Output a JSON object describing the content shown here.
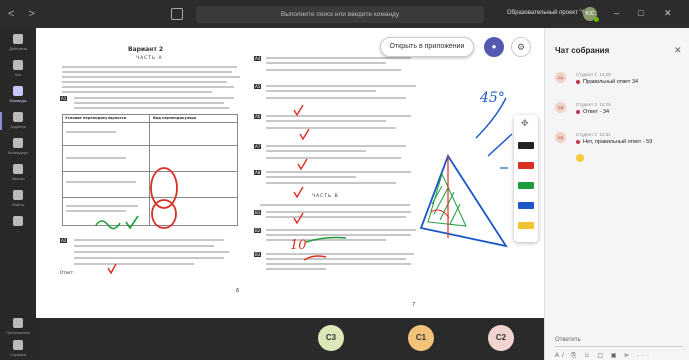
{
  "titlebar": {
    "back": "<",
    "forward": ">",
    "search_placeholder": "Выполните поиск или введите команду",
    "project": "Образовательный проект \"Ф...",
    "avatar": "ЮС",
    "minimize": "–",
    "maximize": "□",
    "close": "✕"
  },
  "rail": {
    "items": [
      {
        "label": "Действия",
        "icon": "bell-icon"
      },
      {
        "label": "Чат",
        "icon": "chat-icon"
      },
      {
        "label": "Команды",
        "icon": "teams-icon"
      },
      {
        "label": "Задания",
        "icon": "assignments-icon"
      },
      {
        "label": "Календарь",
        "icon": "calendar-icon"
      },
      {
        "label": "Звонки",
        "icon": "phone-icon"
      },
      {
        "label": "Файлы",
        "icon": "files-icon"
      },
      {
        "label": "...",
        "icon": "more-icon"
      }
    ],
    "bottom": [
      {
        "label": "Приложения",
        "icon": "apps-icon"
      },
      {
        "label": "Справка",
        "icon": "help-icon"
      }
    ]
  },
  "stage": {
    "open_app": "Открыть в приложении",
    "user_btn_icon": "person-icon",
    "settings_icon": "gear-icon"
  },
  "doc": {
    "left_heading": "Вариант 2",
    "left_part": "ЧАСТЬ А",
    "right_part": "ЧАСТЬ В",
    "table_head_1": "Условие перпендикулярности",
    "table_head_2": "Вид перпендикуляра",
    "page_no_left": "6",
    "page_no_right": "7",
    "answer_label": "Ответ:",
    "tasks_left": [
      "A1",
      "A2",
      "A3"
    ],
    "tasks_right": [
      "A4",
      "A5",
      "A6",
      "A7",
      "A8",
      "B1",
      "B2",
      "B3"
    ]
  },
  "tools": [
    {
      "name": "move-tool",
      "color": "#777777"
    },
    {
      "name": "black-pen",
      "color": "#222222"
    },
    {
      "name": "red-pen",
      "color": "#d93025"
    },
    {
      "name": "green-pen",
      "color": "#1e9e3a"
    },
    {
      "name": "blue-pen",
      "color": "#1a56c8"
    },
    {
      "name": "highlighter",
      "color": "#f2c230"
    }
  ],
  "tiles": [
    {
      "label": "C3",
      "bg": "#dce8b8"
    },
    {
      "label": "C1",
      "bg": "#f3c27a"
    },
    {
      "label": "C2",
      "bg": "#f0d4cf"
    }
  ],
  "chat": {
    "title": "Чат собрания",
    "close": "✕",
    "messages": [
      {
        "avatar": "C1",
        "author": "Студент 1",
        "time": "14:29",
        "text": "Правильный ответ 34",
        "important": true
      },
      {
        "avatar": "C3",
        "author": "Студент 3",
        "time": "14:29",
        "text": "Ответ - 34",
        "important": true
      },
      {
        "avatar": "C2",
        "author": "Студент 2",
        "time": "14:31",
        "text": "Нет, правильный ответ - 59",
        "important": true
      }
    ],
    "reply": "Ответить",
    "compose_tools": "A/ ⎘ ☺ ▢ ▣ ⊳ ···"
  },
  "annotations": {
    "angle": "45°",
    "answer_mark": "10"
  }
}
